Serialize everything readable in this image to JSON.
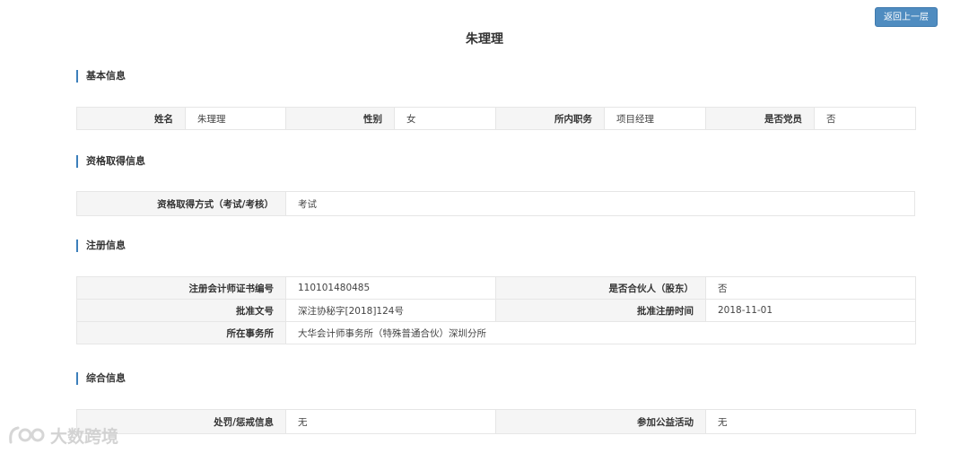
{
  "header": {
    "title": "朱理理",
    "back_label": "返回上一层"
  },
  "basic": {
    "title": "基本信息",
    "row": [
      {
        "label": "姓名",
        "value": "朱理理"
      },
      {
        "label": "性别",
        "value": "女"
      },
      {
        "label": "所内职务",
        "value": "项目经理"
      },
      {
        "label": "是否党员",
        "value": "否"
      }
    ]
  },
  "qualification": {
    "title": "资格取得信息",
    "label": "资格取得方式（考试/考核）",
    "value": "考试"
  },
  "registration": {
    "title": "注册信息",
    "cert_label": "注册会计师证书编号",
    "cert_value": "110101480485",
    "partner_label": "是否合伙人（股东）",
    "partner_value": "否",
    "approval_label": "批准文号",
    "approval_value": "深注协秘字[2018]124号",
    "date_label": "批准注册时间",
    "date_value": "2018-11-01",
    "firm_label": "所在事务所",
    "firm_value": "大华会计师事务所（特殊普通合伙）深圳分所"
  },
  "general": {
    "title": "综合信息",
    "penalty_label": "处罚/惩戒信息",
    "penalty_value": "无",
    "charity_label": "参加公益活动",
    "charity_value": "无"
  },
  "watermark": {
    "text": "大数跨境"
  }
}
